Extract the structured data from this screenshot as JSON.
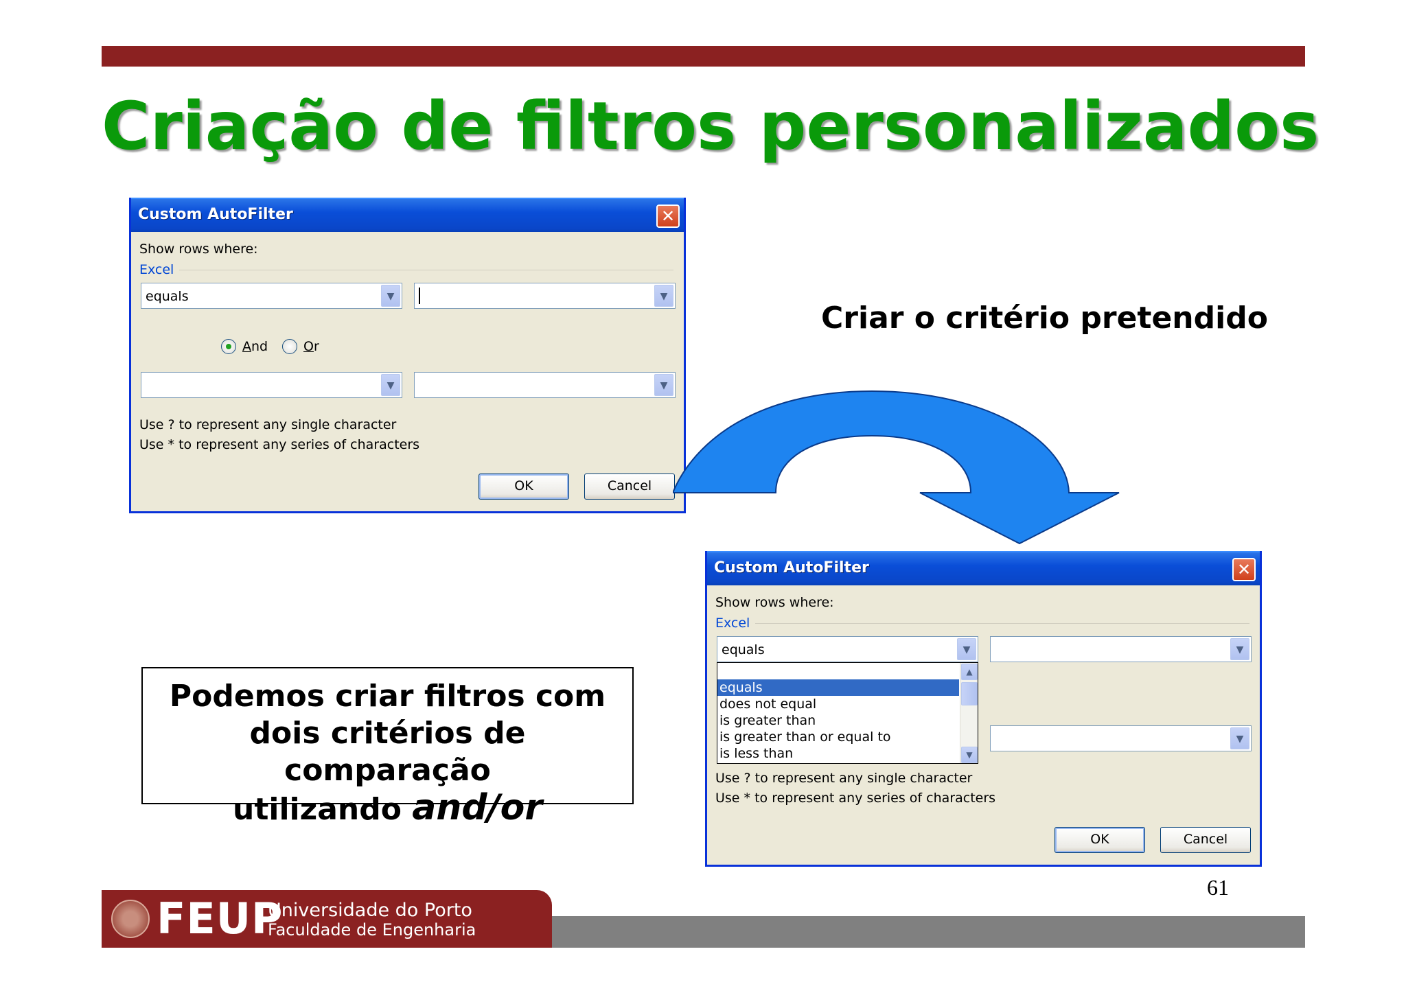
{
  "slide": {
    "title": "Criação de filtros personalizados",
    "caption": "Criar o critério pretendido",
    "note_line1": "Podemos criar filtros com",
    "note_line2": "dois critérios de comparação",
    "note_line3_prefix": "utilizando ",
    "note_line3_emphasis": "and/or",
    "page_number": "61"
  },
  "dialog1": {
    "title": "Custom AutoFilter",
    "show_rows": "Show rows where:",
    "field": "Excel",
    "op1": "equals",
    "val1": "",
    "and_label": "And",
    "or_label": "Or",
    "selected": "And",
    "op2": "",
    "val2": "",
    "hint1": "Use ? to represent any single character",
    "hint2": "Use * to represent any series of characters",
    "ok": "OK",
    "cancel": "Cancel"
  },
  "dialog2": {
    "title": "Custom AutoFilter",
    "show_rows": "Show rows where:",
    "field": "Excel",
    "op1": "equals",
    "val1": "",
    "val2": "",
    "dropdown_options": [
      "equals",
      "does not equal",
      "is greater than",
      "is greater than or equal to",
      "is less than"
    ],
    "dropdown_selected": "equals",
    "hint1": "Use ? to represent any single character",
    "hint2": "Use * to represent any series of characters",
    "ok": "OK",
    "cancel": "Cancel"
  },
  "footer": {
    "logo": "FEUP",
    "university": "Universidade do Porto",
    "faculty": "Faculdade de Engenharia"
  },
  "colors": {
    "title_green": "#0a9a0a",
    "top_bar": "#8b2121",
    "arrow_blue": "#1e84f0",
    "xp_blue": "#0a4ed8",
    "dialog_bg": "#ece9d8"
  }
}
